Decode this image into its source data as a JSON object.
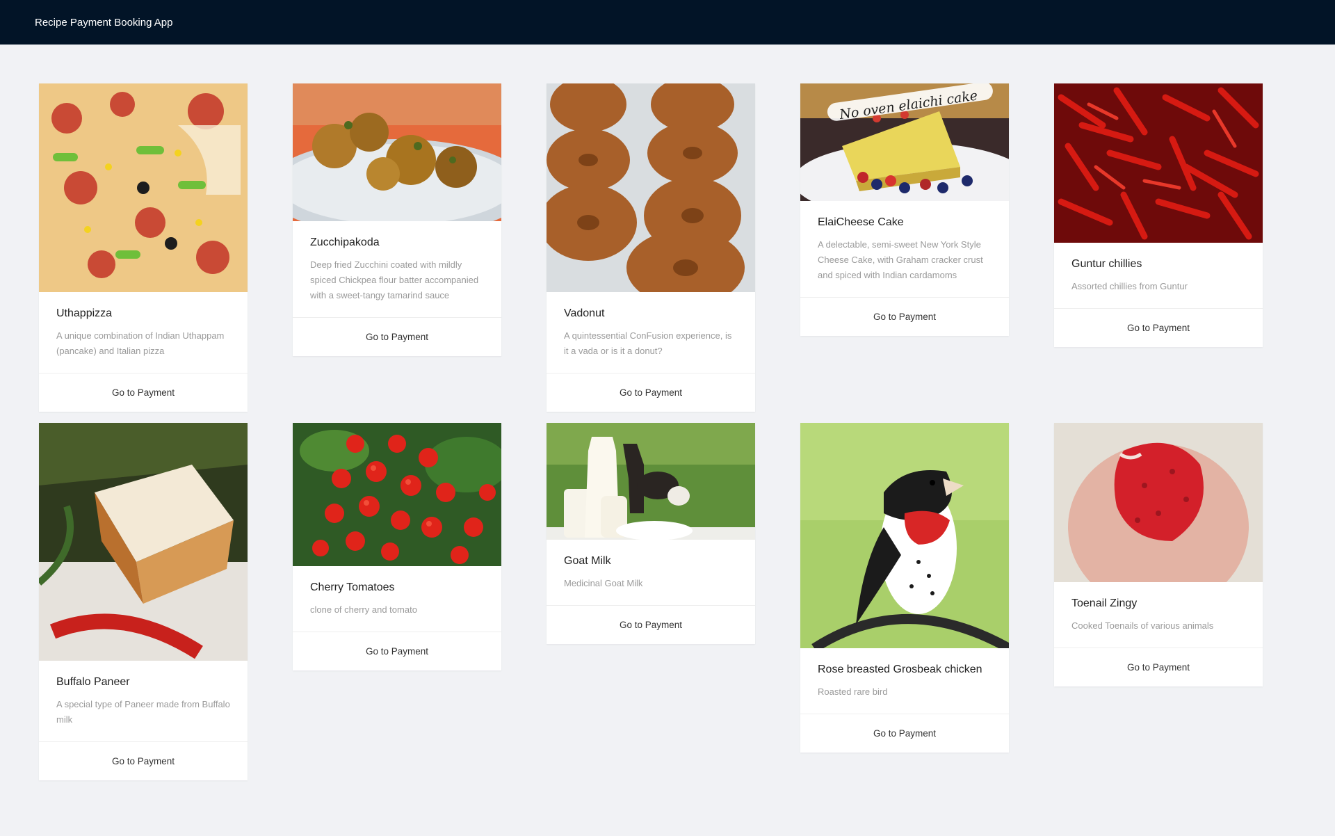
{
  "app": {
    "title": "Recipe Payment Booking App"
  },
  "dishes": [
    {
      "name": "Uthappizza",
      "description": "A unique combination of Indian Uthappam (pancake) and Italian pizza",
      "action": "Go to Payment"
    },
    {
      "name": "Zucchipakoda",
      "description": "Deep fried Zucchini coated with mildly spiced Chickpea flour batter accompanied with a sweet-tangy tamarind sauce",
      "action": "Go to Payment"
    },
    {
      "name": "Vadonut",
      "description": "A quintessential ConFusion experience, is it a vada or is it a donut?",
      "action": "Go to Payment"
    },
    {
      "name": "ElaiCheese Cake",
      "description": "A delectable, semi-sweet New York Style Cheese Cake, with Graham cracker crust and spiced with Indian cardamoms",
      "action": "Go to Payment",
      "image_text": "No oven elaichi cake"
    },
    {
      "name": "Guntur chillies",
      "description": "Assorted chillies from Guntur",
      "action": "Go to Payment"
    },
    {
      "name": "Buffalo Paneer",
      "description": "A special type of Paneer made from Buffalo milk",
      "action": "Go to Payment"
    },
    {
      "name": "Cherry Tomatoes",
      "description": "clone of cherry and tomato",
      "action": "Go to Payment"
    },
    {
      "name": "Goat Milk",
      "description": "Medicinal Goat Milk",
      "action": "Go to Payment"
    },
    {
      "name": "Rose breasted Grosbeak chicken",
      "description": "Roasted rare bird",
      "action": "Go to Payment"
    },
    {
      "name": "Toenail Zingy",
      "description": "Cooked Toenails of various animals",
      "action": "Go to Payment"
    }
  ]
}
